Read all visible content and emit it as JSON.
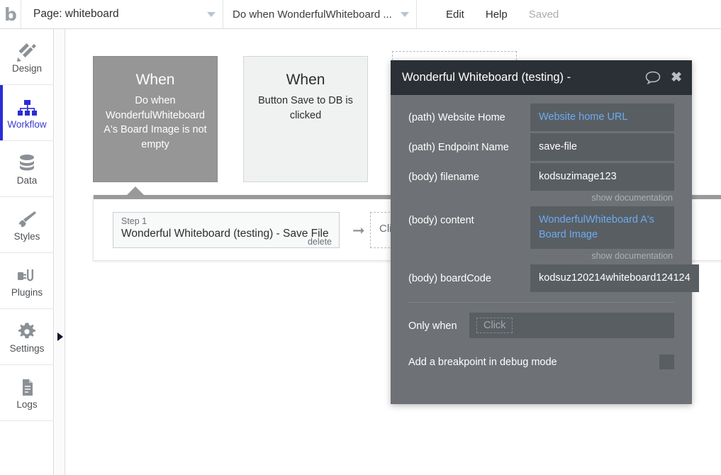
{
  "topbar": {
    "logo": "b-logo-icon",
    "page_selector": {
      "label": "Page: whiteboard",
      "caret": "chevron-down-icon"
    },
    "workflow_selector": {
      "label": "Do when WonderfulWhiteboard ...",
      "caret": "chevron-down-icon"
    },
    "menu": [
      {
        "label": "Edit",
        "muted": false
      },
      {
        "label": "Help",
        "muted": false
      },
      {
        "label": "Saved",
        "muted": true
      }
    ]
  },
  "sidebar": {
    "items": [
      {
        "label": "Design",
        "icon": "design-icon",
        "active": false
      },
      {
        "label": "Workflow",
        "icon": "workflow-icon",
        "active": true
      },
      {
        "label": "Data",
        "icon": "database-icon",
        "active": false
      },
      {
        "label": "Styles",
        "icon": "brush-icon",
        "active": false
      },
      {
        "label": "Plugins",
        "icon": "plug-icon",
        "active": false
      },
      {
        "label": "Settings",
        "icon": "gear-icon",
        "active": false
      },
      {
        "label": "Logs",
        "icon": "document-icon",
        "active": false
      }
    ],
    "collapse_arrow": "expand-right-icon"
  },
  "canvas": {
    "events": [
      {
        "when": "When",
        "description": "Do when WonderfulWhiteboard A's Board Image is not empty",
        "selected": true
      },
      {
        "when": "When",
        "description": "Button Save to DB is clicked",
        "selected": false
      }
    ],
    "step_panel": {
      "step_number": "Step 1",
      "step_title": "Wonderful Whiteboard (testing) - Save File",
      "delete_label": "delete",
      "arrow_icon": "arrow-right-icon",
      "add_action_label": "Click here to add an action..."
    }
  },
  "dialog": {
    "title": "Wonderful Whiteboard (testing) - ",
    "comment_icon": "comment-bubble-icon",
    "close_icon": "close-icon",
    "fields": [
      {
        "label": "(path) Website Home",
        "value": "Website home URL",
        "dynamic": true,
        "doc": null
      },
      {
        "label": "(path) Endpoint Name",
        "value": "save-file",
        "dynamic": false,
        "doc": null
      },
      {
        "label": "(body) filename",
        "value": "kodsuzimage123",
        "dynamic": false,
        "doc": "show documentation"
      },
      {
        "label": "(body) content",
        "value": "WonderfulWhiteboard A's Board Image",
        "dynamic": true,
        "doc": "show documentation"
      },
      {
        "label": "(body) boardCode",
        "value": "kodsuz120214whiteboard124124",
        "dynamic": false,
        "doc": null
      }
    ],
    "only_when": {
      "label": "Only when",
      "placeholder": "Click"
    },
    "breakpoint": {
      "label": "Add a breakpoint in debug mode",
      "checked": false
    }
  },
  "colors": {
    "accent_blue": "#2b2bd8",
    "dialog_header": "#2b3036",
    "dialog_body": "#6e7276",
    "field_bg": "#595e63",
    "dynamic_text": "#6cacf0",
    "selected_event": "#969696"
  }
}
